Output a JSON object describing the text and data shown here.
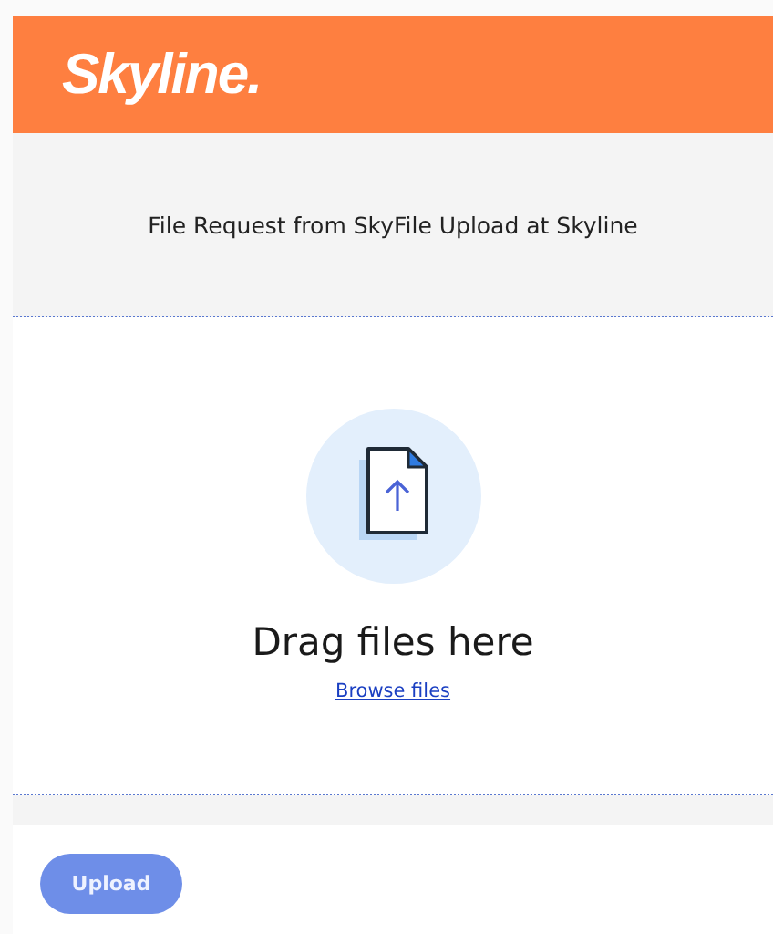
{
  "header": {
    "logo": "Skyline."
  },
  "request_title": "File Request from SkyFile Upload at Skyline",
  "dropzone": {
    "prompt": "Drag files here",
    "browse_link": "Browse files"
  },
  "upload_button": {
    "label": "Upload",
    "disabled": true
  }
}
